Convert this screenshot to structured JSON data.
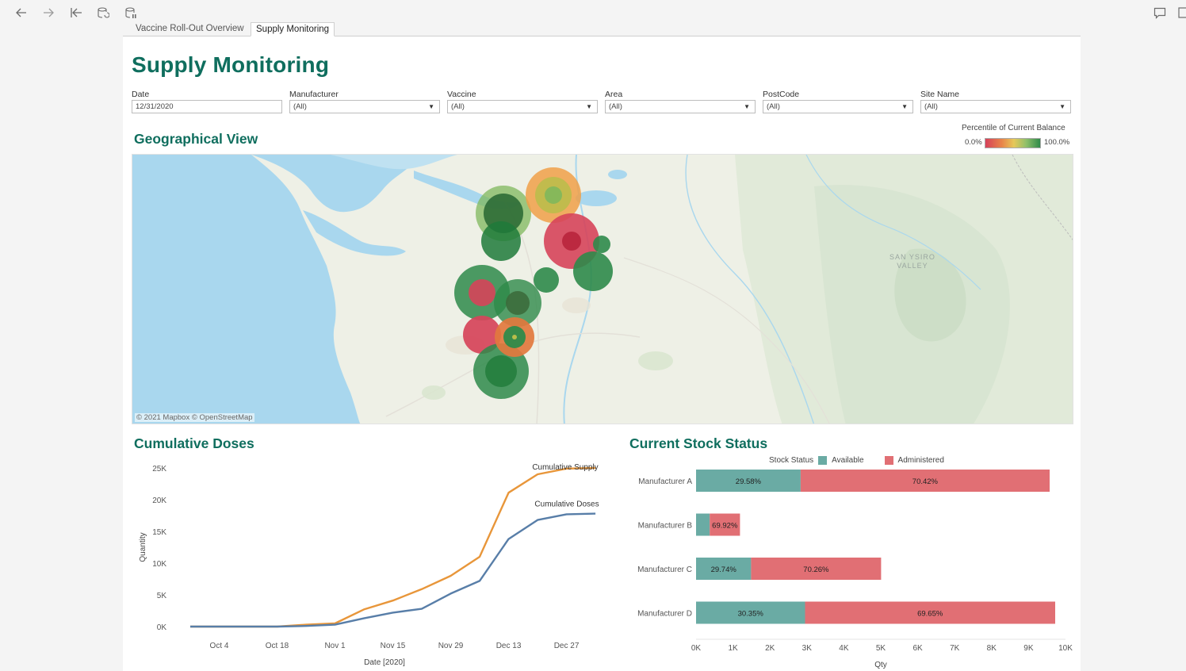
{
  "toolbar": {
    "buttons": [
      {
        "name": "back-arrow-icon"
      },
      {
        "name": "forward-arrow-icon"
      },
      {
        "name": "revert-to-first-icon"
      },
      {
        "name": "refresh-data-icon"
      },
      {
        "name": "pause-updates-icon"
      }
    ],
    "right_buttons": [
      {
        "name": "comment-icon"
      },
      {
        "name": "fullscreen-icon"
      }
    ]
  },
  "tabs": [
    {
      "label": "Vaccine Roll-Out Overview",
      "active": false
    },
    {
      "label": "Supply Monitoring",
      "active": true
    }
  ],
  "page": {
    "title": "Supply Monitoring"
  },
  "filters": [
    {
      "label": "Date",
      "value": "12/31/2020",
      "dropdown": false
    },
    {
      "label": "Manufacturer",
      "value": "(All)",
      "dropdown": true
    },
    {
      "label": "Vaccine",
      "value": "(All)",
      "dropdown": true
    },
    {
      "label": "Area",
      "value": "(All)",
      "dropdown": true
    },
    {
      "label": "PostCode",
      "value": "(All)",
      "dropdown": true
    },
    {
      "label": "Site Name",
      "value": "(All)",
      "dropdown": true
    }
  ],
  "geo": {
    "title": "Geographical View",
    "legend_title": "Percentile of Current Balance",
    "legend_min": "0.0%",
    "legend_max": "100.0%",
    "attribution": "© 2021 Mapbox  © OpenStreetMap",
    "place_label_line1": "SAN YSIRO",
    "place_label_line2": "VALLEY"
  },
  "cumulative": {
    "title": "Cumulative Doses"
  },
  "stock": {
    "title": "Current Stock Status",
    "legend_title": "Stock Status",
    "legend_available": "Available",
    "legend_administered": "Administered"
  },
  "colors": {
    "brand_green": "#0f6e5e",
    "supply_line": "#e8963a",
    "doses_line": "#587ea8",
    "available": "#6aaba4",
    "administered": "#e16f74"
  },
  "chart_data": [
    {
      "type": "line",
      "title": "Cumulative Doses",
      "xlabel": "Date [2020]",
      "ylabel": "Quantity",
      "x_ticks": [
        "Oct 4",
        "Oct 18",
        "Nov 1",
        "Nov 15",
        "Nov 29",
        "Dec 13",
        "Dec 27"
      ],
      "y_ticks": [
        "0K",
        "5K",
        "10K",
        "15K",
        "20K",
        "25K"
      ],
      "ylim": [
        0,
        25000
      ],
      "x": [
        "Sep 27",
        "Oct 4",
        "Oct 11",
        "Oct 18",
        "Oct 25",
        "Nov 1",
        "Nov 8",
        "Nov 15",
        "Nov 22",
        "Nov 29",
        "Dec 6",
        "Dec 13",
        "Dec 20",
        "Dec 27",
        "Dec 31"
      ],
      "series": [
        {
          "name": "Cumulative Supply",
          "values": [
            0,
            0,
            0,
            0,
            300,
            500,
            2700,
            4100,
            5900,
            8000,
            11000,
            21100,
            24000,
            24900,
            25000
          ]
        },
        {
          "name": "Cumulative Doses",
          "values": [
            0,
            0,
            0,
            0,
            100,
            300,
            1300,
            2200,
            2800,
            5200,
            7200,
            13800,
            16800,
            17700,
            17800
          ]
        }
      ],
      "grid": false,
      "legend": "labels at line ends"
    },
    {
      "type": "bar",
      "orientation": "horizontal",
      "stacked": true,
      "title": "Current Stock Status",
      "xlabel": "Qty",
      "ylabel": "",
      "x_ticks": [
        "0K",
        "1K",
        "2K",
        "3K",
        "4K",
        "5K",
        "6K",
        "7K",
        "8K",
        "9K",
        "10K"
      ],
      "xlim": [
        0,
        10000
      ],
      "categories": [
        "Manufacturer A",
        "Manufacturer B",
        "Manufacturer C",
        "Manufacturer D"
      ],
      "series": [
        {
          "name": "Available",
          "values": [
            2830,
            370,
            1490,
            2950
          ],
          "labels": [
            "29.58%",
            "",
            "29.74%",
            "30.35%"
          ]
        },
        {
          "name": "Administered",
          "values": [
            6740,
            820,
            3520,
            6770
          ],
          "labels": [
            "70.42%",
            "69.92%",
            "70.26%",
            "69.65%"
          ]
        }
      ],
      "legend": "top"
    }
  ]
}
